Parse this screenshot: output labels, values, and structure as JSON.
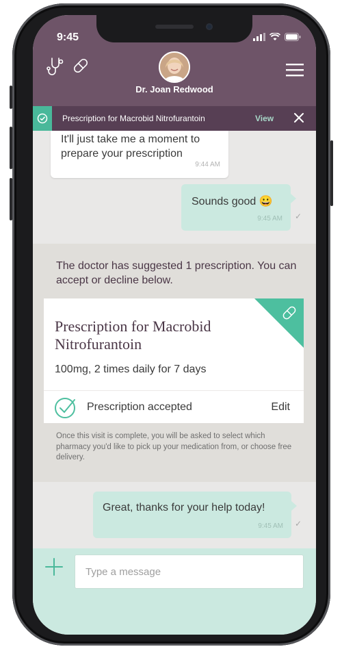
{
  "status_bar": {
    "time": "9:45"
  },
  "header": {
    "doctor_name": "Dr. Joan Redwood",
    "icons": [
      "stethoscope-icon",
      "pill-icon",
      "menu-icon"
    ]
  },
  "banner": {
    "text": "Prescription for Macrobid Nitrofurantoin",
    "view_label": "View"
  },
  "messages": [
    {
      "from": "doctor",
      "text": "It'll just take me a moment to prepare your prescription",
      "time": "9:44 AM"
    },
    {
      "from": "patient",
      "text": "Sounds good 😀",
      "time": "9:45 AM",
      "read": true
    },
    {
      "from": "patient",
      "text": "Great, thanks for your help today!",
      "time": "9:45 AM",
      "read": true
    }
  ],
  "prescription": {
    "intro": "The doctor has suggested 1 prescription. You can accept or decline below.",
    "title": "Prescription for Macrobid Nitrofurantoin",
    "dosage": "100mg, 2 times daily for 7 days",
    "status": "Prescription accepted",
    "edit_label": "Edit",
    "note": "Once this visit is complete, you will be asked to select which pharmacy you'd like to pick up your medication from, or choose free delivery."
  },
  "composer": {
    "placeholder": "Type a message"
  },
  "colors": {
    "header": "#6e5468",
    "banner": "#573f54",
    "accent": "#4dbf9f",
    "bubble_out": "#cbe9e0"
  }
}
